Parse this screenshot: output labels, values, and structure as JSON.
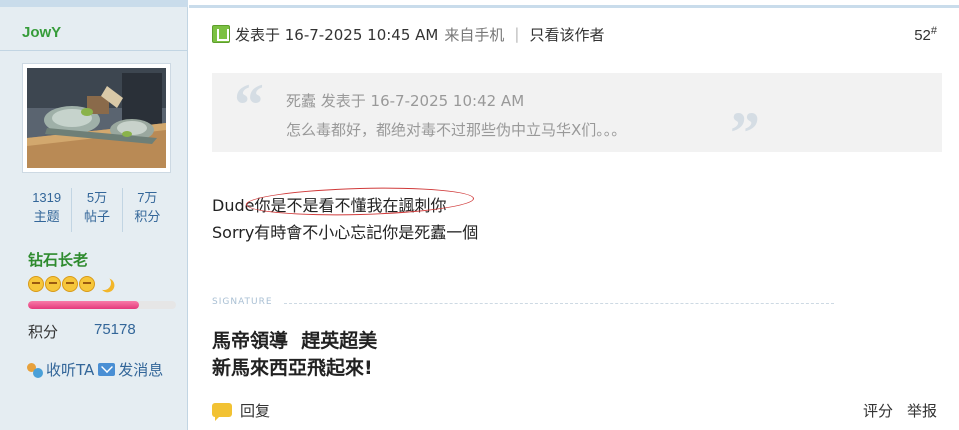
{
  "author": {
    "name": "JowY",
    "stats": [
      {
        "value": "1319",
        "label": "主题"
      },
      {
        "value": "5万",
        "label": "帖子"
      },
      {
        "value": "7万",
        "label": "积分"
      }
    ],
    "rank": "钻石长老",
    "rank_progress": 0.75,
    "points_label": "积分",
    "points_value": "75178",
    "follow_label": "收听TA",
    "message_label": "发消息"
  },
  "post": {
    "posted_at": "发表于 16-7-2025 10:45 AM",
    "source": "来自手机",
    "separator": "|",
    "author_only": "只看该作者",
    "floor_number": "52",
    "floor_mark": "#",
    "quote": {
      "header": "死蠹 发表于 16-7-2025 10:42 AM",
      "text": "怎么毒都好，都绝对毒不过那些伪中立马华X们。。。"
    },
    "body_line1": "Dude你是不是看不懂我在諷刺你",
    "body_line2": "Sorry有時會不小心忘記你是死蠹一個",
    "signature_label": "SIGNATURE",
    "signature_line1": "馬帝領導  趕英超美",
    "signature_line2": "新馬來西亞飛起來!",
    "reply_label": "回复",
    "rate_label": "评分",
    "report_label": "举报"
  },
  "colors": {
    "sidebar_bg": "#e5edf2",
    "username": "#369c3a",
    "rank": "#2e8b2e",
    "link_blue": "#336699",
    "annotation_circle": "#d03a3a"
  }
}
